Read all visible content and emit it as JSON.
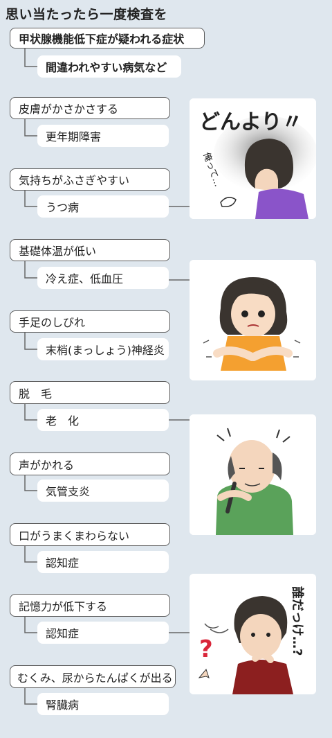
{
  "title": "思い当たったら一度検査を",
  "header_box": {
    "main": "甲状腺機能低下症が疑われる症状",
    "sub": "間違われやすい病気など"
  },
  "groups": [
    {
      "symptom": "皮膚がかさかさする",
      "disease": "更年期障害"
    },
    {
      "symptom": "気持ちがふさぎやすい",
      "disease": "うつ病"
    },
    {
      "symptom": "基礎体温が低い",
      "disease": "冷え症、低血圧"
    },
    {
      "symptom": "手足のしびれ",
      "disease": "末梢(まっしょう)神経炎"
    },
    {
      "symptom": "脱　毛",
      "disease": "老　化"
    },
    {
      "symptom": "声がかれる",
      "disease": "気管支炎"
    },
    {
      "symptom": "口がうまくまわらない",
      "disease": "認知症"
    },
    {
      "symptom": "記憶力が低下する",
      "disease": "認知症"
    },
    {
      "symptom": "むくみ、尿からたんぱくが出る",
      "disease": "腎臓病"
    }
  ],
  "illustrations": [
    {
      "caption": "どんより〃",
      "note": "俺って…"
    },
    {
      "caption": ""
    },
    {
      "caption": ""
    },
    {
      "caption": "誰だっけ…?",
      "mark": "?"
    }
  ]
}
